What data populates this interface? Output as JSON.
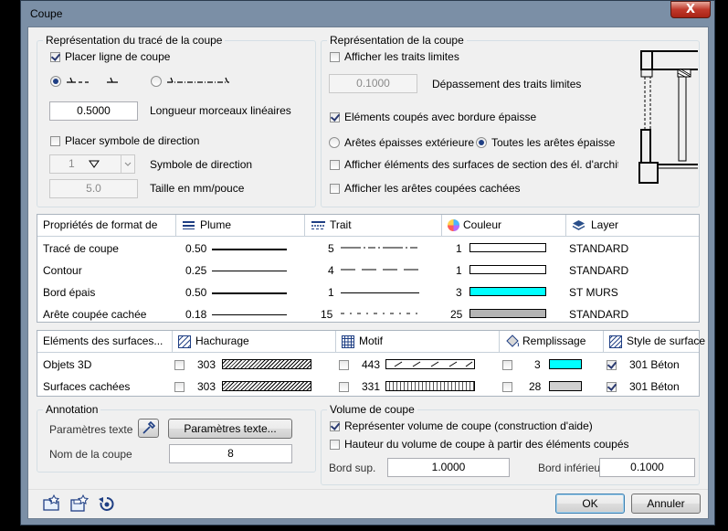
{
  "window": {
    "title": "Coupe",
    "close_label": "X"
  },
  "trace": {
    "group_title": "Représentation du tracé de la coupe",
    "placer_ligne_label": "Placer ligne de coupe",
    "longueur_value": "0.5000",
    "longueur_label": "Longueur morceaux linéaires",
    "placer_symbole_label": "Placer symbole de direction",
    "symbole_value": "1",
    "symbole_label": "Symbole de direction",
    "taille_value": "5.0",
    "taille_label": "Taille en mm/pouce"
  },
  "representation": {
    "group_title": "Représentation de la coupe",
    "traits_limites_label": "Afficher les traits limites",
    "depassement_value": "0.1000",
    "depassement_label": "Dépassement des traits limites",
    "elements_bordure_label": "Eléments coupés avec bordure épaisse",
    "aretes_ext_label": "Arêtes épaisses extérieures",
    "toutes_aretes_label": "Toutes les arêtes épaisses",
    "afficher_elements_label": "Afficher éléments des surfaces de section des él. d'archit.",
    "aretes_cachees_label": "Afficher les arêtes coupées cachées"
  },
  "format_table": {
    "headers": [
      "Propriétés de format de",
      "Plume",
      "Trait",
      "Couleur",
      "Layer"
    ],
    "rows": [
      {
        "name": "Tracé de coupe",
        "plume": "0.50",
        "trait": "5",
        "couleur": "1",
        "color": "#ffffff",
        "layer": "STANDARD"
      },
      {
        "name": "Contour",
        "plume": "0.25",
        "trait": "4",
        "couleur": "1",
        "color": "#ffffff",
        "layer": "STANDARD"
      },
      {
        "name": "Bord épais",
        "plume": "0.50",
        "trait": "1",
        "couleur": "3",
        "color": "#00ffff",
        "layer": "ST MURS"
      },
      {
        "name": "Arête coupée cachée",
        "plume": "0.18",
        "trait": "15",
        "couleur": "25",
        "color": "#b4b4b4",
        "layer": "STANDARD"
      }
    ]
  },
  "surface_table": {
    "headers": [
      "Eléments des surfaces...",
      "Hachurage",
      "Motif",
      "Remplissage",
      "Style de surface"
    ],
    "rows": [
      {
        "name": "Objets 3D",
        "hachurage": "303",
        "motif": "443",
        "remplissage": "3",
        "fill_color": "#00ffff",
        "style": "301 Béton"
      },
      {
        "name": "Surfaces cachées",
        "hachurage": "303",
        "motif": "331",
        "remplissage": "28",
        "fill_color": "#d0d0d0",
        "style": "301 Béton"
      }
    ]
  },
  "annotation": {
    "group_title": "Annotation",
    "params_label": "Paramètres texte",
    "params_button": "Paramètres texte...",
    "nom_label": "Nom de la coupe",
    "nom_value": "8"
  },
  "volume": {
    "group_title": "Volume de coupe",
    "representer_label": "Représenter volume de coupe (construction d'aide)",
    "hauteur_label": "Hauteur du volume de coupe à partir des éléments coupés",
    "bord_sup_label": "Bord sup.",
    "bord_sup_value": "1.0000",
    "bord_inf_label": "Bord inférieur",
    "bord_inf_value": "0.1000"
  },
  "footer": {
    "ok_label": "OK",
    "cancel_label": "Annuler"
  }
}
